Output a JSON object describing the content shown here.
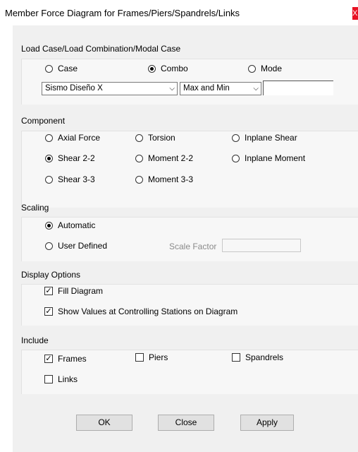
{
  "window": {
    "title": "Member Force Diagram for Frames/Piers/Spandrels/Links",
    "close_glyph": "X"
  },
  "load_case": {
    "label": "Load Case/Load Combination/Modal Case",
    "options": [
      "Case",
      "Combo",
      "Mode"
    ],
    "selected": "Combo",
    "combo_value": "Sismo Diseño X",
    "envelope_value": "Max and Min",
    "extra_value": ""
  },
  "component": {
    "label": "Component",
    "options": [
      "Axial Force",
      "Torsion",
      "Inplane Shear",
      "Shear 2-2",
      "Moment 2-2",
      "Inplane Moment",
      "Shear 3-3",
      "Moment 3-3"
    ],
    "selected": "Shear 2-2"
  },
  "scaling": {
    "label": "Scaling",
    "options": [
      "Automatic",
      "User Defined"
    ],
    "selected": "Automatic",
    "scale_factor_label": "Scale Factor",
    "scale_factor_value": ""
  },
  "display_options": {
    "label": "Display Options",
    "fill_diagram": "Fill Diagram",
    "fill_diagram_checked": true,
    "show_values": "Show Values at Controlling Stations on Diagram",
    "show_values_checked": true
  },
  "include": {
    "label": "Include",
    "frames": "Frames",
    "frames_checked": true,
    "piers": "Piers",
    "piers_checked": false,
    "spandrels": "Spandrels",
    "spandrels_checked": false,
    "links": "Links",
    "links_checked": false
  },
  "buttons": {
    "ok": "OK",
    "close": "Close",
    "apply": "Apply"
  }
}
